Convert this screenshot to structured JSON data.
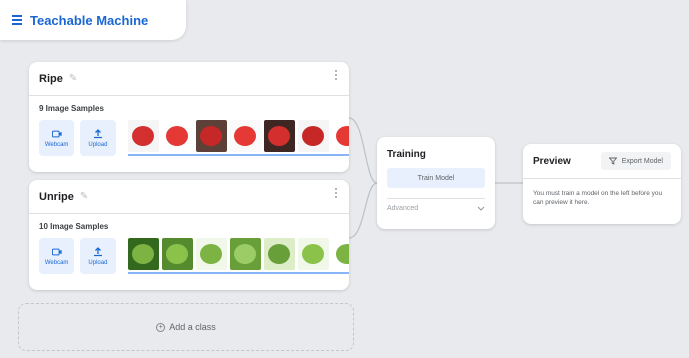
{
  "app": {
    "title": "Teachable Machine"
  },
  "classes": [
    {
      "name": "Ripe",
      "samples_label": "9 Image Samples",
      "webcam_label": "Webcam",
      "upload_label": "Upload",
      "thumbs": [
        {
          "bg": "#f5f5f5",
          "fruit": "#d32f2f"
        },
        {
          "bg": "#ffffff",
          "fruit": "#e53935"
        },
        {
          "bg": "#5d4037",
          "fruit": "#c62828"
        },
        {
          "bg": "#fafafa",
          "fruit": "#e53935"
        },
        {
          "bg": "#3e2723",
          "fruit": "#d32f2f"
        },
        {
          "bg": "#f5f5f5",
          "fruit": "#c62828"
        },
        {
          "bg": "#ffffff",
          "fruit": "#e53935"
        }
      ]
    },
    {
      "name": "Unripe",
      "samples_label": "10 Image Samples",
      "webcam_label": "Webcam",
      "upload_label": "Upload",
      "thumbs": [
        {
          "bg": "#33691e",
          "fruit": "#7cb342"
        },
        {
          "bg": "#558b2f",
          "fruit": "#8bc34a"
        },
        {
          "bg": "#f1f8e9",
          "fruit": "#7cb342"
        },
        {
          "bg": "#689f38",
          "fruit": "#9ccc65"
        },
        {
          "bg": "#dcedc8",
          "fruit": "#689f38"
        },
        {
          "bg": "#f1f8e9",
          "fruit": "#8bc34a"
        },
        {
          "bg": "#ffffff",
          "fruit": "#7cb342"
        }
      ]
    }
  ],
  "add_class_label": "Add a class",
  "training": {
    "title": "Training",
    "train_button": "Train Model",
    "advanced_label": "Advanced"
  },
  "preview": {
    "title": "Preview",
    "export_button": "Export Model",
    "message": "You must train a model on the left before you can preview it here."
  },
  "colors": {
    "accent": "#1967d2",
    "accent_light": "#e8f0fe",
    "background": "#e8eaed"
  }
}
